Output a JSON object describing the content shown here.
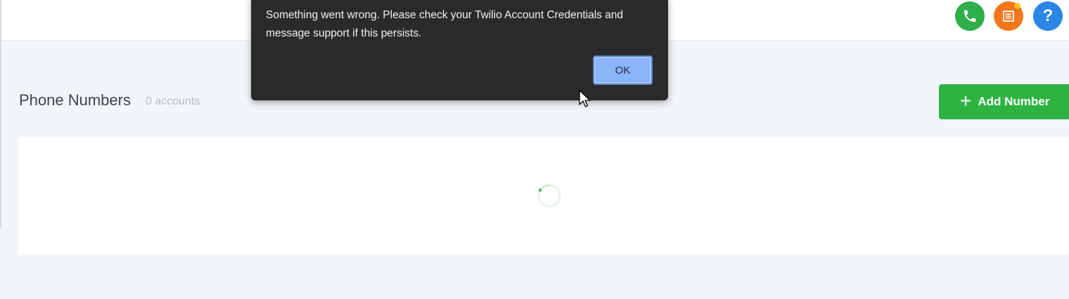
{
  "header": {
    "icons": [
      {
        "name": "phone-icon",
        "color": "#2fae4c"
      },
      {
        "name": "notes-icon",
        "color": "#f4761c"
      },
      {
        "name": "help-icon",
        "color": "#2b86e6",
        "glyph": "?"
      }
    ]
  },
  "page": {
    "title": "Phone Numbers",
    "count": "0 accounts",
    "add_button_label": "Add Number"
  },
  "dialog": {
    "message": "Something went wrong. Please check your Twilio Account Credentials and message support if this persists.",
    "ok_label": "OK"
  },
  "colors": {
    "accent_green": "#2eb343",
    "dialog_bg": "#2a2a2a",
    "ok_button": "#8ab4f8"
  }
}
